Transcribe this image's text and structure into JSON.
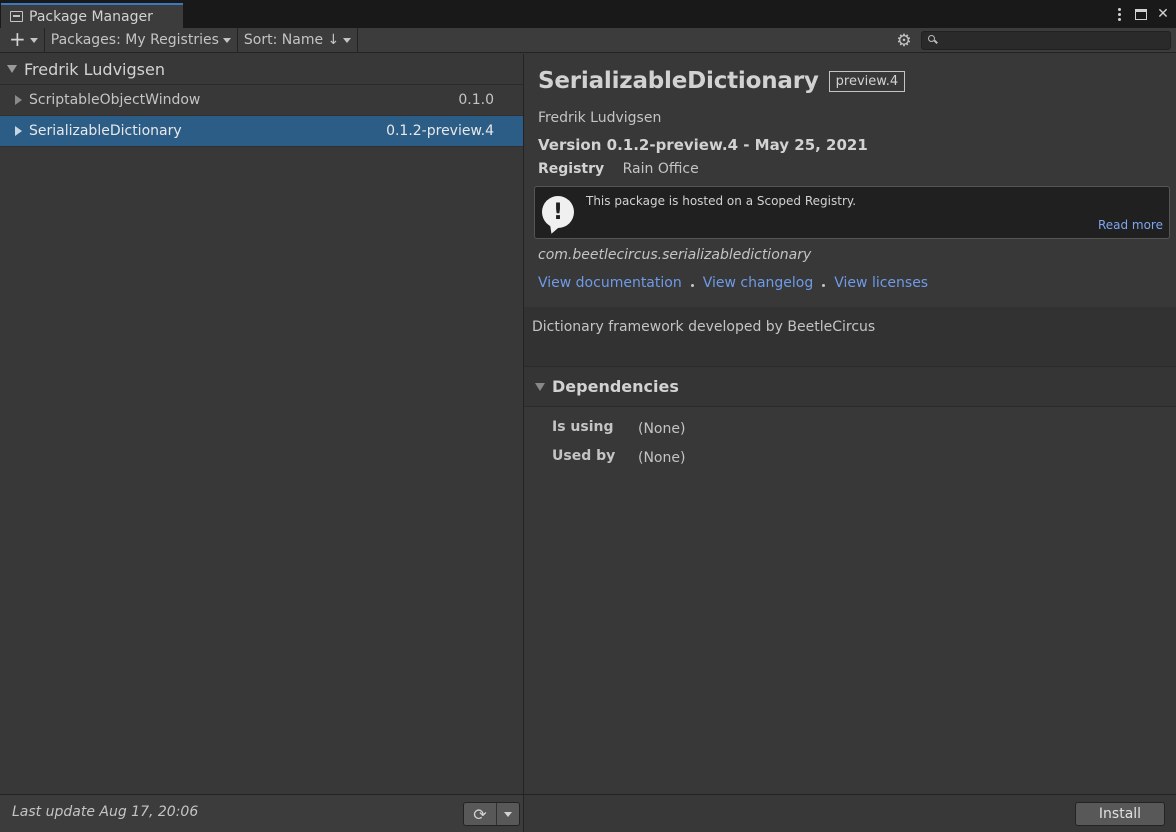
{
  "window": {
    "title": "Package Manager"
  },
  "toolbar": {
    "add_label": "+",
    "packages_filter": "Packages: My Registries",
    "sort_label": "Sort: Name ↓",
    "search_placeholder": ""
  },
  "package_list": {
    "group_title": "Fredrik Ludvigsen",
    "items": [
      {
        "name": "ScriptableObjectWindow",
        "version": "0.1.0",
        "selected": false
      },
      {
        "name": "SerializableDictionary",
        "version": "0.1.2-preview.4",
        "selected": true
      }
    ],
    "last_update": "Last update Aug 17, 20:06"
  },
  "details": {
    "title": "SerializableDictionary",
    "badge": "preview.4",
    "author": "Fredrik Ludvigsen",
    "version_line": "Version 0.1.2-preview.4 - May 25, 2021",
    "registry_label": "Registry",
    "registry_value": "Rain Office",
    "notice_text": "This package is hosted on a Scoped Registry.",
    "notice_link": "Read more",
    "package_id": "com.beetlecircus.serializabledictionary",
    "links": {
      "documentation": "View documentation",
      "changelog": "View changelog",
      "licenses": "View licenses"
    },
    "description": "Dictionary framework developed by BeetleCircus",
    "dependencies": {
      "title": "Dependencies",
      "is_using_label": "Is using",
      "is_using_value": "(None)",
      "used_by_label": "Used by",
      "used_by_value": "(None)"
    },
    "install_label": "Install"
  },
  "colors": {
    "accent": "#3a79bb",
    "selection": "#2c5d87",
    "link": "#6f9ae8"
  }
}
